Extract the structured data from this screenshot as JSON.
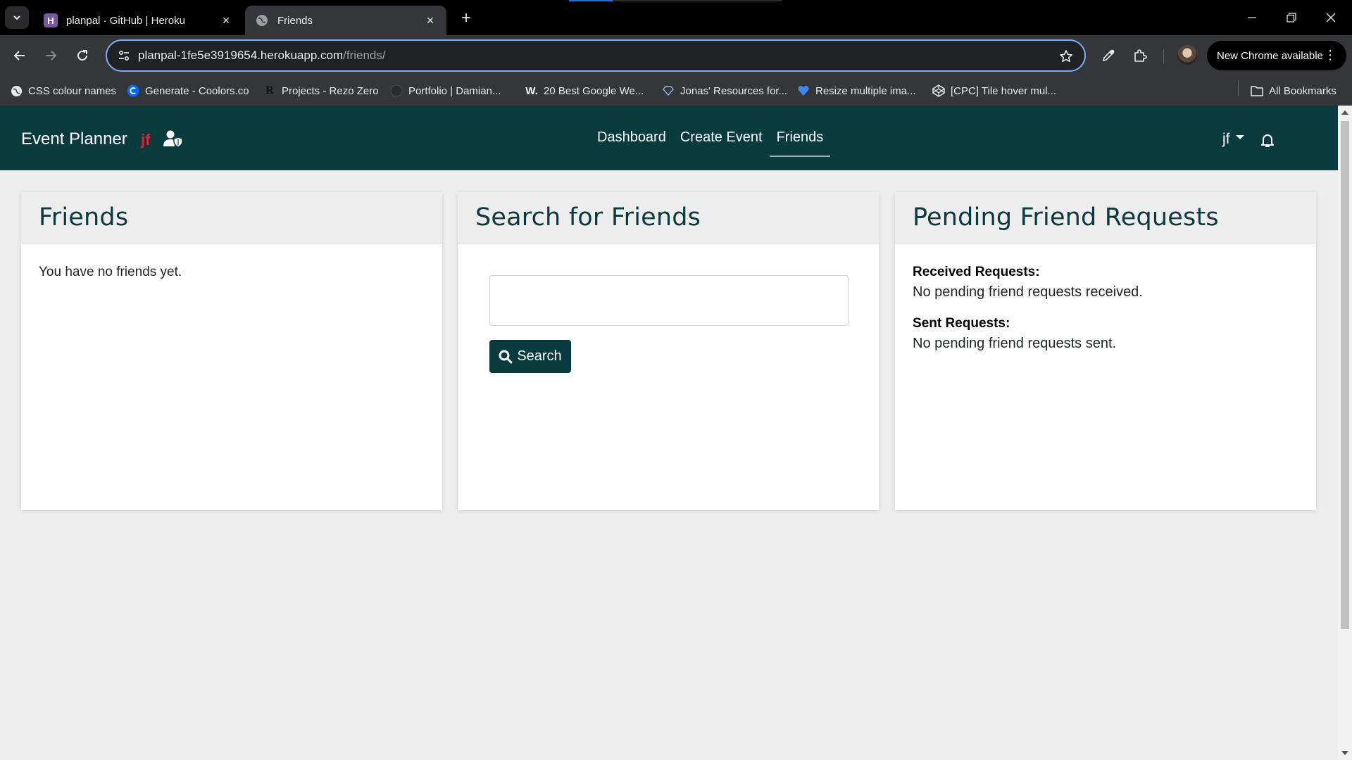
{
  "browser": {
    "tabs": [
      {
        "title": "planpal · GitHub | Heroku",
        "active": false,
        "favicon": "heroku-icon"
      },
      {
        "title": "Friends",
        "active": true,
        "favicon": "globe-icon"
      }
    ],
    "url_host": "planpal-1fe5e3919654.herokuapp.com",
    "url_path": "/friends/",
    "update_button": "New Chrome available",
    "bookmarks": [
      {
        "label": "CSS colour names",
        "icon": "globe-icon"
      },
      {
        "label": "Generate - Coolors.co",
        "icon": "coolors-icon"
      },
      {
        "label": "Projects - Rezo Zero",
        "icon": "rezo-icon"
      },
      {
        "label": "Portfolio | Damian...",
        "icon": "portfolio-icon"
      },
      {
        "label": "20 Best Google We...",
        "icon": "w-icon"
      },
      {
        "label": "Jonas' Resources for...",
        "icon": "heart-outline-icon"
      },
      {
        "label": "Resize multiple ima...",
        "icon": "heart-icon"
      },
      {
        "label": "[CPC] Tile hover mul...",
        "icon": "codepen-icon"
      }
    ],
    "all_bookmarks": "All Bookmarks"
  },
  "app": {
    "brand": "Event Planner",
    "brand_user": "jf",
    "nav": [
      "Dashboard",
      "Create Event",
      "Friends"
    ],
    "active_nav": "Friends",
    "user_menu": "jf",
    "colors": {
      "nav_bg": "#093a3e",
      "accent_red": "#e5202e",
      "page_bg": "#eeeded"
    }
  },
  "friends_card": {
    "title": "Friends",
    "empty_text": "You have no friends yet."
  },
  "search_card": {
    "title": "Search for Friends",
    "input_value": "",
    "button_label": "Search"
  },
  "pending_card": {
    "title": "Pending Friend Requests",
    "received_label": "Received Requests:",
    "received_text": "No pending friend requests received.",
    "sent_label": "Sent Requests:",
    "sent_text": "No pending friend requests sent."
  }
}
